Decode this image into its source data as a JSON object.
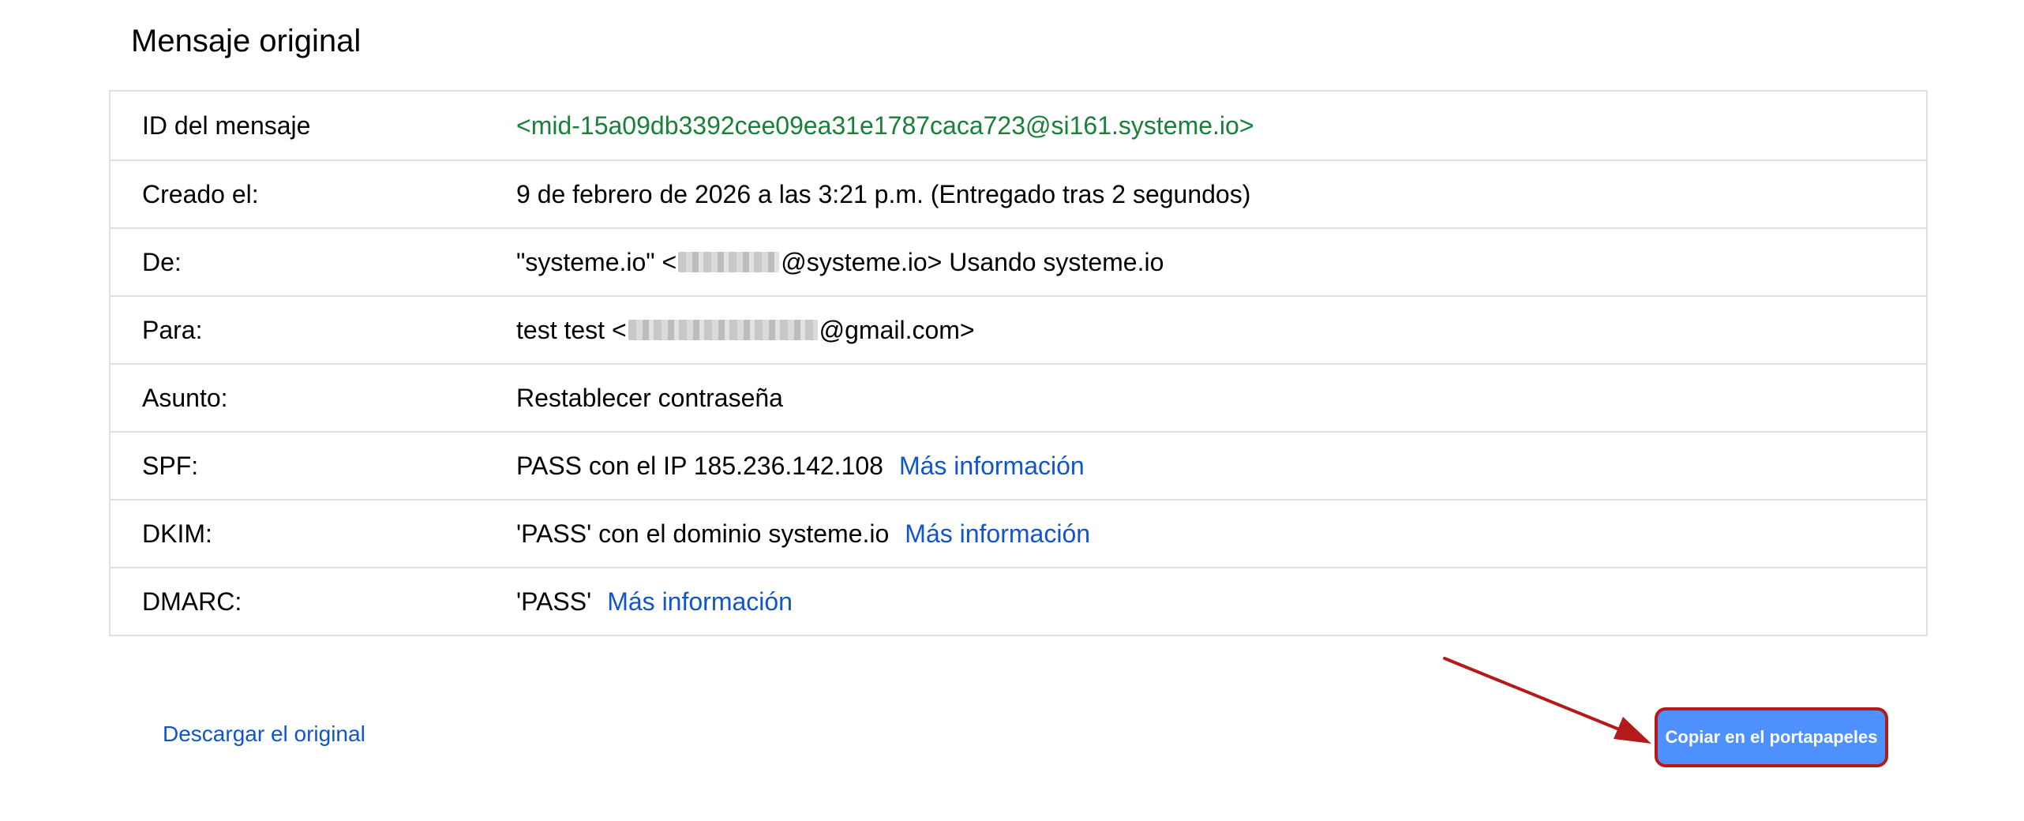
{
  "page": {
    "title": "Mensaje original"
  },
  "headers": {
    "rows": [
      {
        "label": "ID del mensaje",
        "value": "<mid-15a09db3392cee09ea31e1787caca723@si161.systeme.io>"
      },
      {
        "label": "Creado el:",
        "value": "9 de febrero de 2026 a las 3:21 p.m. (Entregado tras 2 segundos)"
      },
      {
        "label": "De:",
        "value_prefix": "\"systeme.io\" <",
        "value_suffix": "@systeme.io> Usando systeme.io"
      },
      {
        "label": "Para:",
        "value_prefix": "test test <",
        "value_suffix": "@gmail.com>"
      },
      {
        "label": "Asunto:",
        "value": "Restablecer contraseña"
      },
      {
        "label": "SPF:",
        "value": "PASS con el IP 185.236.142.108",
        "link": "Más información"
      },
      {
        "label": "DKIM:",
        "value": "'PASS' con el dominio systeme.io",
        "link": "Más información"
      },
      {
        "label": "DMARC:",
        "value": "'PASS'",
        "link": "Más información"
      }
    ]
  },
  "actions": {
    "download_label": "Descargar el original",
    "copy_label": "Copiar en el portapapeles"
  },
  "colors": {
    "message_id": "#188038",
    "link": "#1155cc",
    "button_bg": "#4d90fe",
    "annotation": "#b51a1a"
  }
}
